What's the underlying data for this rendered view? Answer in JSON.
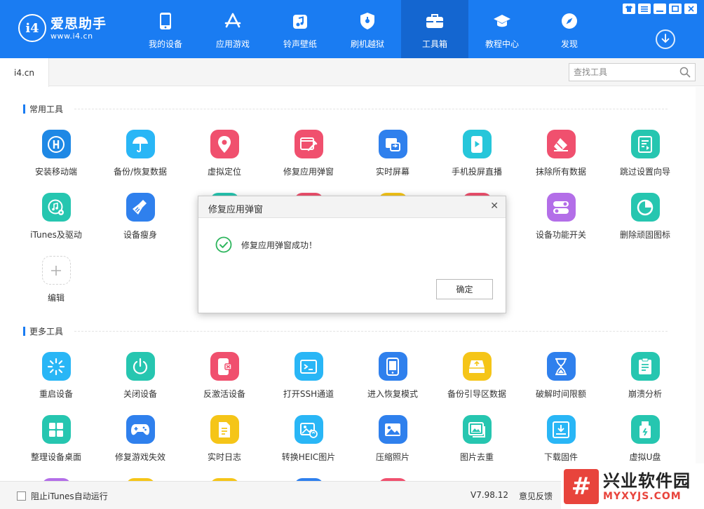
{
  "app": {
    "logo_badge": "i4",
    "logo_title": "爱思助手",
    "logo_url": "www.i4.cn",
    "accent": "#1a7cf2"
  },
  "nav": {
    "items": [
      {
        "label": "我的设备",
        "icon": "phone-icon"
      },
      {
        "label": "应用游戏",
        "icon": "app-store-icon"
      },
      {
        "label": "铃声壁纸",
        "icon": "music-note-icon"
      },
      {
        "label": "刷机越狱",
        "icon": "shield-icon"
      },
      {
        "label": "工具箱",
        "icon": "toolbox-icon",
        "active": true
      },
      {
        "label": "教程中心",
        "icon": "graduation-cap-icon"
      },
      {
        "label": "发现",
        "icon": "compass-icon"
      }
    ]
  },
  "window_controls": [
    "shirt-icon",
    "menu-icon",
    "minimize-icon",
    "maximize-icon",
    "close-icon"
  ],
  "tabbar": {
    "tab_label": "i4.cn",
    "search_placeholder": "查找工具"
  },
  "sections": {
    "common": {
      "title": "常用工具",
      "tools": [
        {
          "label": "安装移动端",
          "icon": "i4-app-icon",
          "color": "#1e88e5"
        },
        {
          "label": "备份/恢复数据",
          "icon": "umbrella-icon",
          "color": "#29b6f6"
        },
        {
          "label": "虚拟定位",
          "icon": "location-pin-icon",
          "color": "#f0506e"
        },
        {
          "label": "修复应用弹窗",
          "icon": "repair-icon",
          "color": "#f0506e"
        },
        {
          "label": "实时屏幕",
          "icon": "screen-cast-icon",
          "color": "#2f80ed"
        },
        {
          "label": "手机投屏直播",
          "icon": "phone-play-icon",
          "color": "#26c6da"
        },
        {
          "label": "抹除所有数据",
          "icon": "eraser-icon",
          "color": "#f0506e"
        },
        {
          "label": "跳过设置向导",
          "icon": "skip-setup-icon",
          "color": "#26c6b0"
        },
        {
          "label": "iTunes及驱动",
          "icon": "itunes-icon",
          "color": "#26c6b0"
        },
        {
          "label": "设备瘦身",
          "icon": "broom-icon",
          "color": "#2f80ed"
        },
        {
          "label": "设备功能开关",
          "icon": "toggle-icon",
          "color": "#b36ee8"
        },
        {
          "label": "删除顽固图标",
          "icon": "pie-icon",
          "color": "#26c6b0"
        },
        {
          "label": "编辑",
          "icon": "plus-icon",
          "color": "#ffffff"
        }
      ]
    },
    "more": {
      "title": "更多工具",
      "tools": [
        {
          "label": "重启设备",
          "icon": "restart-icon",
          "color": "#29b6f6"
        },
        {
          "label": "关闭设备",
          "icon": "power-icon",
          "color": "#26c6b0"
        },
        {
          "label": "反激活设备",
          "icon": "deactivate-icon",
          "color": "#f0506e"
        },
        {
          "label": "打开SSH通道",
          "icon": "terminal-icon",
          "color": "#29b6f6"
        },
        {
          "label": "进入恢复模式",
          "icon": "recovery-phone-icon",
          "color": "#2f80ed"
        },
        {
          "label": "备份引导区数据",
          "icon": "backup-drive-icon",
          "color": "#f5c518"
        },
        {
          "label": "破解时间限额",
          "icon": "hourglass-icon",
          "color": "#2f80ed"
        },
        {
          "label": "崩溃分析",
          "icon": "report-icon",
          "color": "#26c6b0"
        },
        {
          "label": "整理设备桌面",
          "icon": "grid-icon",
          "color": "#26c6b0"
        },
        {
          "label": "修复游戏失效",
          "icon": "gamepad-icon",
          "color": "#2f80ed"
        },
        {
          "label": "实时日志",
          "icon": "log-icon",
          "color": "#f5c518"
        },
        {
          "label": "转换HEIC图片",
          "icon": "image-convert-icon",
          "color": "#29b6f6"
        },
        {
          "label": "压缩照片",
          "icon": "photo-icon",
          "color": "#2f80ed"
        },
        {
          "label": "图片去重",
          "icon": "photos-dedupe-icon",
          "color": "#26c6b0"
        },
        {
          "label": "下载固件",
          "icon": "download-firmware-icon",
          "color": "#29b6f6"
        },
        {
          "label": "虚拟U盘",
          "icon": "usb-drive-icon",
          "color": "#26c6b0"
        }
      ]
    }
  },
  "dialog": {
    "title": "修复应用弹窗",
    "message": "修复应用弹窗成功！",
    "confirm_label": "确定"
  },
  "statusbar": {
    "checkbox_label": "阻止iTunes自动运行",
    "checked": false,
    "version": "V7.98.12",
    "feedback": "意见反馈"
  },
  "watermark": {
    "logo_char": "#",
    "title": "兴业软件园",
    "url": "MYXYJS.COM"
  }
}
